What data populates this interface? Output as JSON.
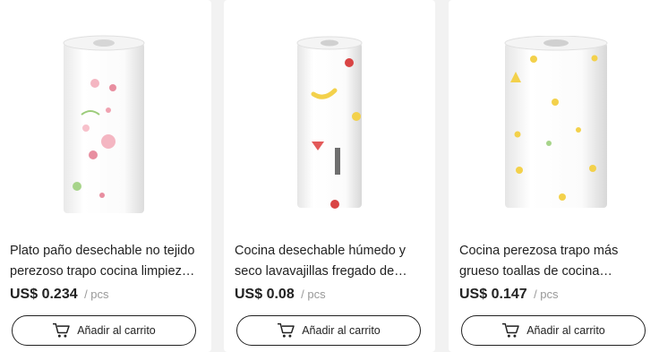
{
  "products": [
    {
      "title": "Plato paño desechable no tejido perezoso trapo cocina limpieza desechable",
      "price": "US$ 0.234",
      "unit": "/ pcs",
      "cart_label": "Añadir al carrito",
      "image_icon": "paper-towel-roll-image"
    },
    {
      "title": "Cocina desechable húmedo y seco lavavajillas fregado de cocina",
      "price": "US$ 0.08",
      "unit": "/ pcs",
      "cart_label": "Añadir al carrito",
      "image_icon": "paper-towel-roll-image"
    },
    {
      "title": "Cocina perezosa trapo más grueso toallas de cocina desechables",
      "price": "US$ 0.147",
      "unit": "/ pcs",
      "cart_label": "Añadir al carrito",
      "image_icon": "paper-towel-roll-image"
    }
  ],
  "icons": {
    "cart": "shopping-cart-icon"
  },
  "colors": {
    "background": "#f2f2f2",
    "card": "#ffffff",
    "text": "#222222",
    "muted": "#999999"
  }
}
